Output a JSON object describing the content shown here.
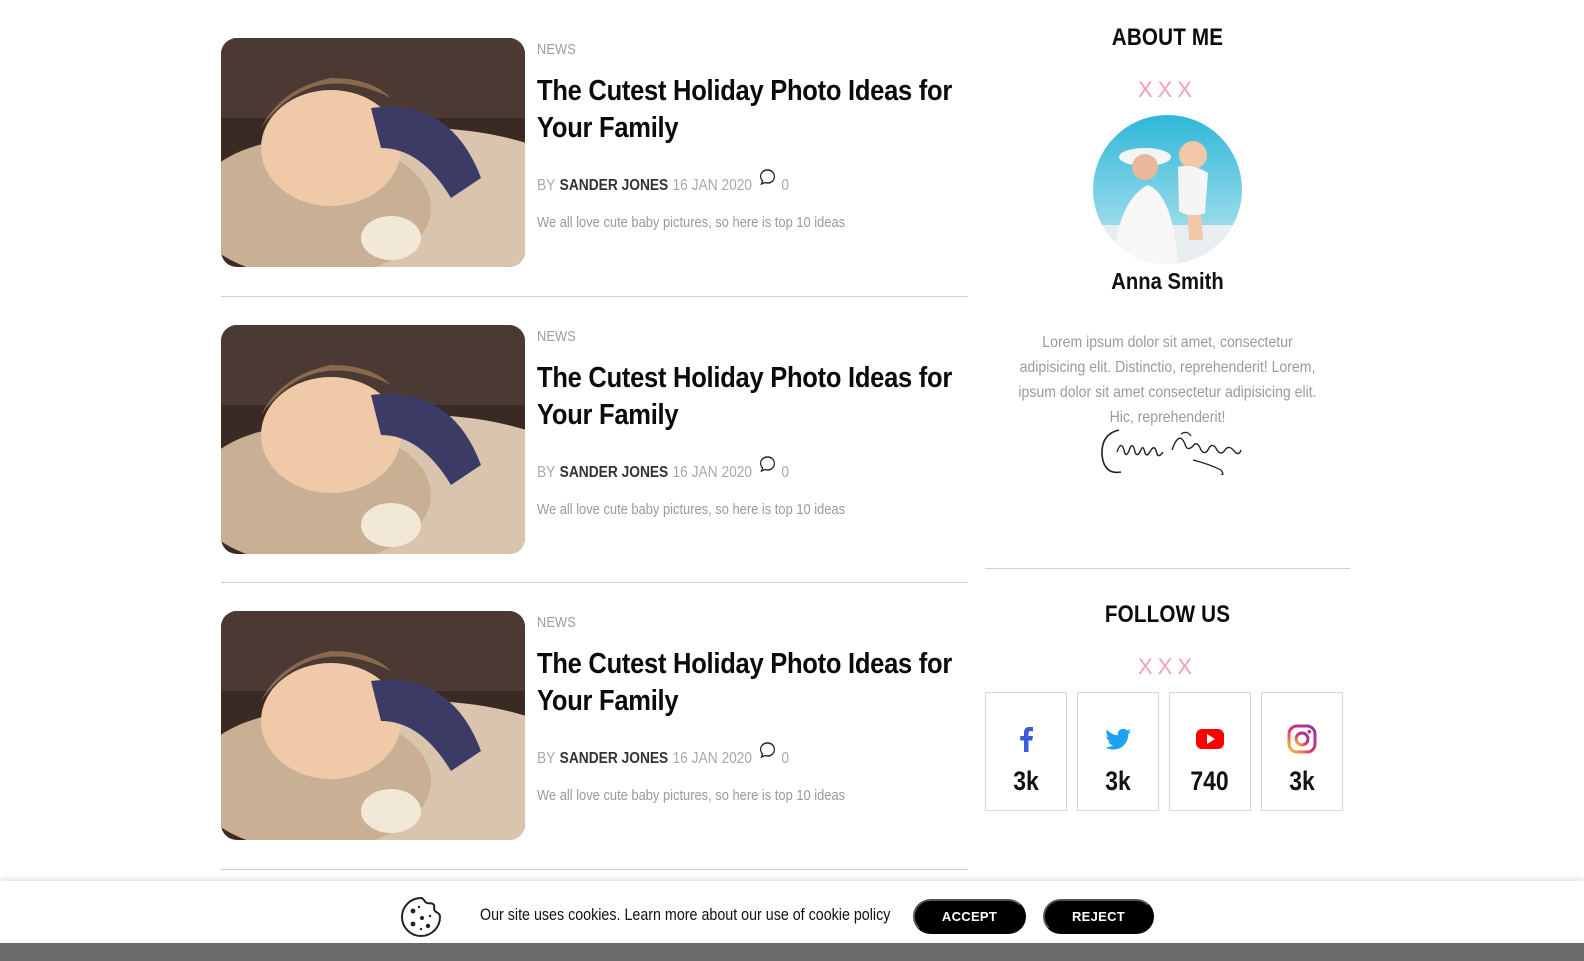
{
  "posts": [
    {
      "category": "NEWS",
      "title": "The Cutest Holiday Photo Ideas for Your Family",
      "by": "BY",
      "author": "SANDER JONES",
      "date": "16 JAN 2020",
      "comments": "0",
      "excerpt": "We all love cute baby pictures, so here is top 10 ideas"
    },
    {
      "category": "NEWS",
      "title": "The Cutest Holiday Photo Ideas for Your Family",
      "by": "BY",
      "author": "SANDER JONES",
      "date": "16 JAN 2020",
      "comments": "0",
      "excerpt": "We all love cute baby pictures, so here is top 10 ideas"
    },
    {
      "category": "NEWS",
      "title": "The Cutest Holiday Photo Ideas for Your Family",
      "by": "BY",
      "author": "SANDER JONES",
      "date": "16 JAN 2020",
      "comments": "0",
      "excerpt": "We all love cute baby pictures, so here is top 10 ideas"
    }
  ],
  "about": {
    "title": "ABOUT ME",
    "ornament": "XXX",
    "name": "Anna Smith",
    "bio": "Lorem ipsum dolor sit amet, consectetur adipisicing elit. Distinctio, reprehenderit! Lorem, ipsum dolor sit amet consectetur adipisicing elit. Hic, reprehenderit!"
  },
  "follow": {
    "title": "FOLLOW US",
    "ornament": "XXX",
    "networks": [
      {
        "icon": "facebook-icon",
        "count": "3k",
        "color": "#3b5bdb"
      },
      {
        "icon": "twitter-icon",
        "count": "3k",
        "color": "#1da1f2"
      },
      {
        "icon": "youtube-icon",
        "count": "740",
        "color": "#ff0000"
      },
      {
        "icon": "instagram-icon",
        "count": "3k",
        "color": "#e1306c"
      }
    ]
  },
  "cookie": {
    "message": "Our site uses cookies. Learn more about our use of cookie policy",
    "accept": "ACCEPT",
    "reject": "REJECT"
  },
  "colors": {
    "accent_pink": "#f3a1b0",
    "muted_text": "#9a9a9a",
    "button_bg": "#000000"
  }
}
